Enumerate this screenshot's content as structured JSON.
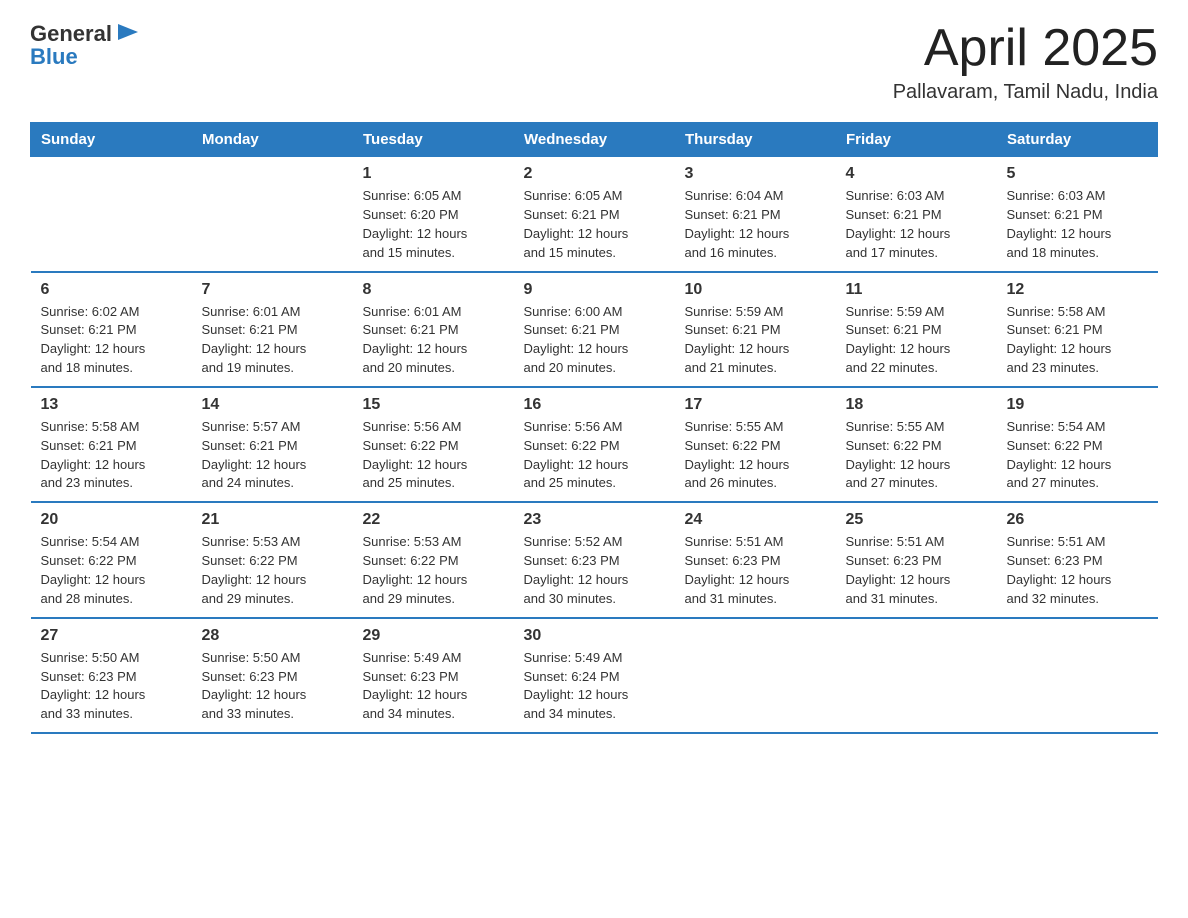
{
  "header": {
    "logo_text_general": "General",
    "logo_text_blue": "Blue",
    "title": "April 2025",
    "subtitle": "Pallavaram, Tamil Nadu, India"
  },
  "days_of_week": [
    "Sunday",
    "Monday",
    "Tuesday",
    "Wednesday",
    "Thursday",
    "Friday",
    "Saturday"
  ],
  "weeks": [
    [
      {
        "day": "",
        "sunrise": "",
        "sunset": "",
        "daylight": ""
      },
      {
        "day": "",
        "sunrise": "",
        "sunset": "",
        "daylight": ""
      },
      {
        "day": "1",
        "sunrise": "6:05 AM",
        "sunset": "6:20 PM",
        "daylight": "12 hours and 15 minutes."
      },
      {
        "day": "2",
        "sunrise": "6:05 AM",
        "sunset": "6:21 PM",
        "daylight": "12 hours and 15 minutes."
      },
      {
        "day": "3",
        "sunrise": "6:04 AM",
        "sunset": "6:21 PM",
        "daylight": "12 hours and 16 minutes."
      },
      {
        "day": "4",
        "sunrise": "6:03 AM",
        "sunset": "6:21 PM",
        "daylight": "12 hours and 17 minutes."
      },
      {
        "day": "5",
        "sunrise": "6:03 AM",
        "sunset": "6:21 PM",
        "daylight": "12 hours and 18 minutes."
      }
    ],
    [
      {
        "day": "6",
        "sunrise": "6:02 AM",
        "sunset": "6:21 PM",
        "daylight": "12 hours and 18 minutes."
      },
      {
        "day": "7",
        "sunrise": "6:01 AM",
        "sunset": "6:21 PM",
        "daylight": "12 hours and 19 minutes."
      },
      {
        "day": "8",
        "sunrise": "6:01 AM",
        "sunset": "6:21 PM",
        "daylight": "12 hours and 20 minutes."
      },
      {
        "day": "9",
        "sunrise": "6:00 AM",
        "sunset": "6:21 PM",
        "daylight": "12 hours and 20 minutes."
      },
      {
        "day": "10",
        "sunrise": "5:59 AM",
        "sunset": "6:21 PM",
        "daylight": "12 hours and 21 minutes."
      },
      {
        "day": "11",
        "sunrise": "5:59 AM",
        "sunset": "6:21 PM",
        "daylight": "12 hours and 22 minutes."
      },
      {
        "day": "12",
        "sunrise": "5:58 AM",
        "sunset": "6:21 PM",
        "daylight": "12 hours and 23 minutes."
      }
    ],
    [
      {
        "day": "13",
        "sunrise": "5:58 AM",
        "sunset": "6:21 PM",
        "daylight": "12 hours and 23 minutes."
      },
      {
        "day": "14",
        "sunrise": "5:57 AM",
        "sunset": "6:21 PM",
        "daylight": "12 hours and 24 minutes."
      },
      {
        "day": "15",
        "sunrise": "5:56 AM",
        "sunset": "6:22 PM",
        "daylight": "12 hours and 25 minutes."
      },
      {
        "day": "16",
        "sunrise": "5:56 AM",
        "sunset": "6:22 PM",
        "daylight": "12 hours and 25 minutes."
      },
      {
        "day": "17",
        "sunrise": "5:55 AM",
        "sunset": "6:22 PM",
        "daylight": "12 hours and 26 minutes."
      },
      {
        "day": "18",
        "sunrise": "5:55 AM",
        "sunset": "6:22 PM",
        "daylight": "12 hours and 27 minutes."
      },
      {
        "day": "19",
        "sunrise": "5:54 AM",
        "sunset": "6:22 PM",
        "daylight": "12 hours and 27 minutes."
      }
    ],
    [
      {
        "day": "20",
        "sunrise": "5:54 AM",
        "sunset": "6:22 PM",
        "daylight": "12 hours and 28 minutes."
      },
      {
        "day": "21",
        "sunrise": "5:53 AM",
        "sunset": "6:22 PM",
        "daylight": "12 hours and 29 minutes."
      },
      {
        "day": "22",
        "sunrise": "5:53 AM",
        "sunset": "6:22 PM",
        "daylight": "12 hours and 29 minutes."
      },
      {
        "day": "23",
        "sunrise": "5:52 AM",
        "sunset": "6:23 PM",
        "daylight": "12 hours and 30 minutes."
      },
      {
        "day": "24",
        "sunrise": "5:51 AM",
        "sunset": "6:23 PM",
        "daylight": "12 hours and 31 minutes."
      },
      {
        "day": "25",
        "sunrise": "5:51 AM",
        "sunset": "6:23 PM",
        "daylight": "12 hours and 31 minutes."
      },
      {
        "day": "26",
        "sunrise": "5:51 AM",
        "sunset": "6:23 PM",
        "daylight": "12 hours and 32 minutes."
      }
    ],
    [
      {
        "day": "27",
        "sunrise": "5:50 AM",
        "sunset": "6:23 PM",
        "daylight": "12 hours and 33 minutes."
      },
      {
        "day": "28",
        "sunrise": "5:50 AM",
        "sunset": "6:23 PM",
        "daylight": "12 hours and 33 minutes."
      },
      {
        "day": "29",
        "sunrise": "5:49 AM",
        "sunset": "6:23 PM",
        "daylight": "12 hours and 34 minutes."
      },
      {
        "day": "30",
        "sunrise": "5:49 AM",
        "sunset": "6:24 PM",
        "daylight": "12 hours and 34 minutes."
      },
      {
        "day": "",
        "sunrise": "",
        "sunset": "",
        "daylight": ""
      },
      {
        "day": "",
        "sunrise": "",
        "sunset": "",
        "daylight": ""
      },
      {
        "day": "",
        "sunrise": "",
        "sunset": "",
        "daylight": ""
      }
    ]
  ],
  "labels": {
    "sunrise_prefix": "Sunrise: ",
    "sunset_prefix": "Sunset: ",
    "daylight_prefix": "Daylight: "
  }
}
